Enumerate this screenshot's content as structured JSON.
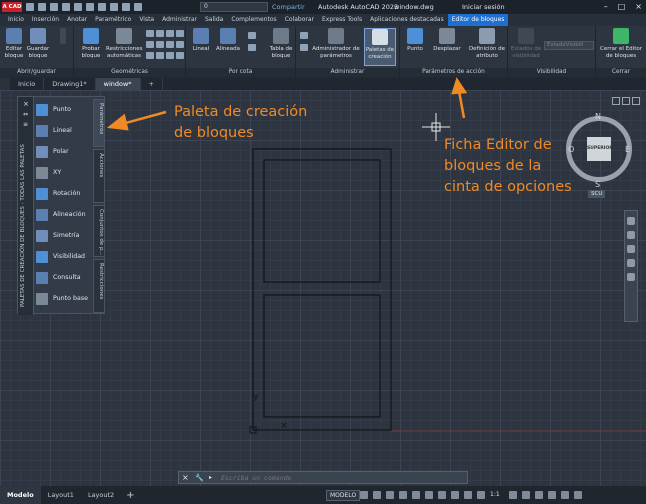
{
  "app": {
    "logo_text": "A CAD",
    "layer_value": "0",
    "share_label": "Compartir",
    "title": "Autodesk AutoCAD 2023",
    "file": "window.dwg",
    "signin_label": "Iniciar sesión"
  },
  "ribbon_tabs": [
    "Inicio",
    "Inserción",
    "Anotar",
    "Paramétrico",
    "Vista",
    "Administrar",
    "Salida",
    "Complementos",
    "Colaborar",
    "Express Tools",
    "Aplicaciones destacadas",
    "Editor de bloques"
  ],
  "active_ribbon_tab": "Editor de bloques",
  "ribbon": {
    "groups": {
      "open_save": "Abrir/guardar",
      "geometric": "Geométricas",
      "dimensional": "Por cota",
      "manage": "Administrar",
      "action_params": "Parámetros de acción",
      "visibility": "Visibilidad",
      "close": "Cerrar"
    },
    "buttons": {
      "edit_block": "Editar bloque",
      "save_block": "Guardar bloque",
      "test_block": "Probar bloque",
      "auto_constraints": "Restricciones automáticas",
      "linear": "Lineal",
      "aligned": "Alineada",
      "block_table": "Tabla de bloque",
      "param_manager": "Administrador de parámetros",
      "authoring_palettes": "Paletas de creación",
      "point": "Punto",
      "move": "Desplazar",
      "attr_def": "Definición de atributo",
      "vis_states": "Estados de visibilidad",
      "vis_combo": "EstadoVisibili",
      "close_editor": "Cerrar el Editor de bloques"
    }
  },
  "doc_tabs": [
    "Inicio",
    "Drawing1*",
    "window*"
  ],
  "active_doc_tab": "window*",
  "palette": {
    "title": "PALETAS DE CREACIÓN DE BLOQUES - TODAS LAS PALETAS",
    "items": [
      "Punto",
      "Lineal",
      "Polar",
      "XY",
      "Rotación",
      "Alineación",
      "Simetría",
      "Visibilidad",
      "Consulta",
      "Punto base"
    ],
    "side_tabs": [
      "Parámetros",
      "Acciones",
      "Conjuntos de p...",
      "Restricciones"
    ]
  },
  "annotations": {
    "palette_note_line1": "Paleta de creación",
    "palette_note_line2": "de bloques",
    "ribbon_note_line1": "Ficha Editor de",
    "ribbon_note_line2": "bloques de la",
    "ribbon_note_line3": "cinta de opciones"
  },
  "viewcube": {
    "face": "SUPERIOR",
    "n": "N",
    "s": "S",
    "e": "E",
    "w": "O",
    "ucs": "SCU"
  },
  "ucs_y_label": "Y",
  "command": {
    "placeholder": "Escriba un comando"
  },
  "status": {
    "layout_tabs": [
      "Modelo",
      "Layout1",
      "Layout2"
    ],
    "active_layout": "Modelo",
    "add_tab": "+",
    "model_toggle": "MODELO",
    "scale": "1:1"
  },
  "colors": {
    "accent": "#1d6fd1",
    "annotation": "#f08a24",
    "brand": "#c8202a"
  }
}
